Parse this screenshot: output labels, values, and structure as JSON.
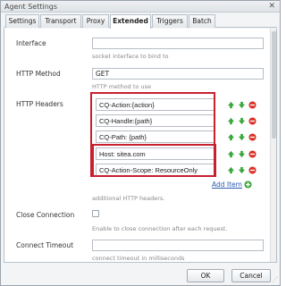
{
  "window": {
    "title": "Agent Settings"
  },
  "tabs": [
    "Settings",
    "Transport",
    "Proxy",
    "Extended",
    "Triggers",
    "Batch"
  ],
  "form": {
    "interface": {
      "label": "Interface",
      "value": "",
      "hint": "socket interface to bind to"
    },
    "http_method": {
      "label": "HTTP Method",
      "value": "GET",
      "hint": "HTTP method to use"
    },
    "http_headers": {
      "label": "HTTP Headers",
      "items": [
        "CQ-Action:{action}",
        "CQ-Handle:{path}",
        "CQ-Path: {path}",
        "Host: sitea.com",
        "CQ-Action-Scope: ResourceOnly"
      ],
      "add_label": "Add Item",
      "hint": "additional HTTP headers."
    },
    "close_connection": {
      "label": "Close Connection",
      "checked": false,
      "hint": "Enable to close connection after each request."
    },
    "connect_timeout": {
      "label": "Connect Timeout",
      "value": "",
      "hint": "connect timeout in milliseconds"
    }
  },
  "buttons": {
    "ok": "OK",
    "cancel": "Cancel"
  },
  "colors": {
    "highlight": "#c9202f",
    "move": "#3aa53a",
    "remove": "#d93025"
  }
}
